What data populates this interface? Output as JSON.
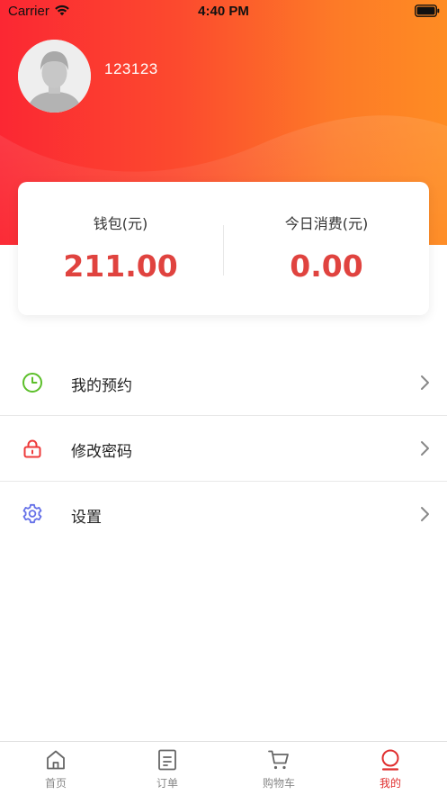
{
  "status_bar": {
    "carrier": "Carrier",
    "time": "4:40 PM"
  },
  "profile": {
    "username": "123123"
  },
  "wallet": {
    "balance_label": "钱包(元)",
    "balance_value": "211.00",
    "today_label": "今日消费(元)",
    "today_value": "0.00"
  },
  "menu": {
    "items": [
      {
        "label": "我的预约",
        "icon": "clock-icon"
      },
      {
        "label": "修改密码",
        "icon": "lock-icon"
      },
      {
        "label": "设置",
        "icon": "gear-icon"
      }
    ]
  },
  "tab_bar": {
    "tabs": [
      {
        "label": "首页",
        "icon": "home-icon"
      },
      {
        "label": "订单",
        "icon": "order-icon"
      },
      {
        "label": "购物车",
        "icon": "cart-icon"
      },
      {
        "label": "我的",
        "icon": "profile-icon",
        "active": true
      }
    ]
  },
  "colors": {
    "header_gradient_start": "#fb2733",
    "header_gradient_end": "#fe8c23",
    "accent_red": "#e0433f",
    "clock_green": "#5cbf2a",
    "lock_red": "#ee3a3a",
    "gear_blue": "#6470e8",
    "tab_active": "#e02e2e"
  }
}
